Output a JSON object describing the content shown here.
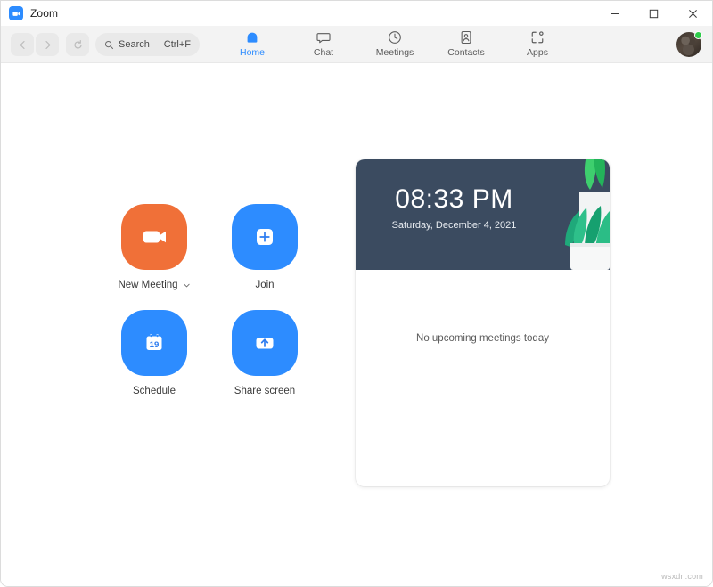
{
  "window": {
    "title": "Zoom",
    "logo_icon": "zoom-camera-logo",
    "controls": {
      "minimize": "minimize-icon",
      "maximize": "maximize-icon",
      "close": "close-icon"
    }
  },
  "toolbar": {
    "back_icon": "chevron-left-icon",
    "forward_icon": "chevron-right-icon",
    "refresh_icon": "refresh-icon",
    "search": {
      "icon": "search-icon",
      "placeholder": "Search",
      "shortcut": "Ctrl+F"
    },
    "tabs": [
      {
        "label": "Home",
        "icon": "home-icon",
        "active": true
      },
      {
        "label": "Chat",
        "icon": "chat-icon",
        "active": false
      },
      {
        "label": "Meetings",
        "icon": "clock-icon",
        "active": false
      },
      {
        "label": "Contacts",
        "icon": "contacts-icon",
        "active": false
      },
      {
        "label": "Apps",
        "icon": "apps-icon",
        "active": false
      }
    ],
    "avatar": {
      "name": "user-avatar",
      "status": "available"
    }
  },
  "annotation": {
    "settings_icon": "gear-icon",
    "highlight_color": "#e02424"
  },
  "actions": [
    {
      "label": "New Meeting",
      "icon": "video-camera-icon",
      "color": "#f07038",
      "has_dropdown": true,
      "dropdown_icon": "chevron-down-icon"
    },
    {
      "label": "Join",
      "icon": "plus-square-icon",
      "color": "#2d8cff",
      "has_dropdown": false,
      "dropdown_icon": ""
    },
    {
      "label": "Schedule",
      "icon": "calendar-icon",
      "color": "#2d8cff",
      "has_dropdown": false,
      "dropdown_icon": ""
    },
    {
      "label": "Share screen",
      "icon": "share-arrow-icon",
      "color": "#2d8cff",
      "has_dropdown": false,
      "dropdown_icon": ""
    }
  ],
  "calendar_icon_day": "19",
  "meetings_card": {
    "clock": {
      "time": "08:33 PM",
      "date": "Saturday, December 4, 2021",
      "background_color": "#3b4b60",
      "decoration_icon": "potted-plant-illustration"
    },
    "empty_state": "No upcoming meetings today"
  },
  "watermark": "wsxdn.com"
}
